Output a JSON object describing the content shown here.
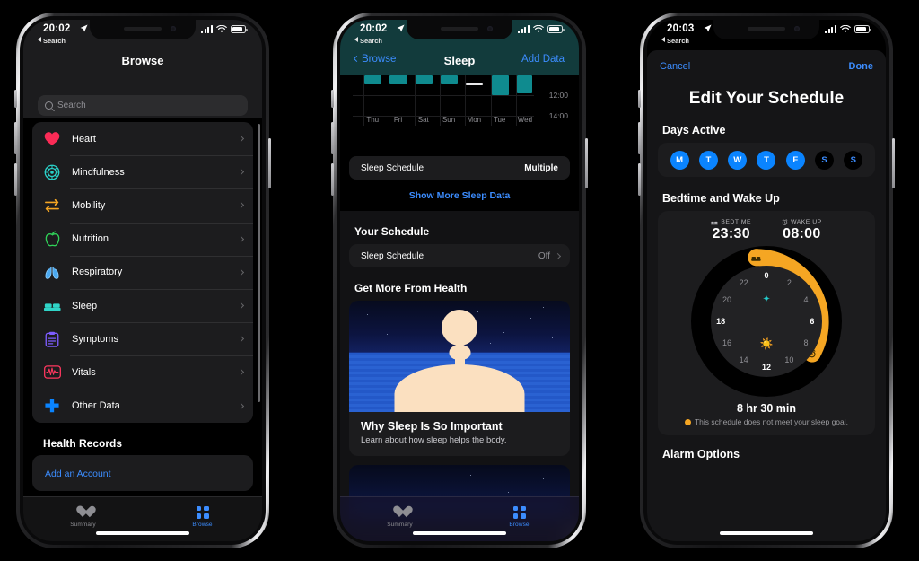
{
  "phone1": {
    "status": {
      "time": "20:02",
      "back_label": "Search",
      "location_icon": "location-arrow-icon",
      "signal_icon": "signal-bars-icon",
      "wifi_icon": "wifi-icon",
      "battery_icon": "battery-icon"
    },
    "nav": {
      "title": "Browse"
    },
    "search": {
      "placeholder": "Search",
      "icon": "search-icon"
    },
    "categories": [
      {
        "label": "Heart",
        "icon": "heart-icon",
        "color": "#fa2b56"
      },
      {
        "label": "Mindfulness",
        "icon": "mindfulness-icon",
        "color": "#2ad0c8"
      },
      {
        "label": "Mobility",
        "icon": "mobility-icon",
        "color": "#f5a623"
      },
      {
        "label": "Nutrition",
        "icon": "apple-icon",
        "color": "#30d158"
      },
      {
        "label": "Respiratory",
        "icon": "lungs-icon",
        "color": "#5ac8fa"
      },
      {
        "label": "Sleep",
        "icon": "bed-icon",
        "color": "#30d5c8"
      },
      {
        "label": "Symptoms",
        "icon": "clipboard-icon",
        "color": "#7d5cff"
      },
      {
        "label": "Vitals",
        "icon": "waveform-icon",
        "color": "#ff375f"
      },
      {
        "label": "Other Data",
        "icon": "plus-icon",
        "color": "#0a84ff"
      }
    ],
    "health_records": {
      "title": "Health Records",
      "action": "Add an Account"
    },
    "tabs": [
      {
        "label": "Summary",
        "icon": "heart-icon",
        "active": false
      },
      {
        "label": "Browse",
        "icon": "grid-icon",
        "active": true
      }
    ]
  },
  "phone2": {
    "status": {
      "time": "20:02",
      "back_label": "Search"
    },
    "nav": {
      "back": "Browse",
      "title": "Sleep",
      "action": "Add Data"
    },
    "chart_data": {
      "type": "bar",
      "title": "Sleep",
      "categories": [
        "Thu",
        "Fri",
        "Sat",
        "Sun",
        "Mon",
        "Tue",
        "Wed"
      ],
      "values": [
        1.0,
        1.0,
        1.0,
        1.0,
        0.1,
        2.1,
        2.0
      ],
      "ytick_labels": [
        "12:00",
        "14:00"
      ],
      "xlabel": "",
      "ylabel": "",
      "series_color": "#0f8b8f",
      "grid": true,
      "legend": "none"
    },
    "sleep_schedule_pill": {
      "label": "Sleep Schedule",
      "value": "Multiple"
    },
    "show_more": "Show More Sleep Data",
    "your_schedule": {
      "title": "Your Schedule",
      "row_label": "Sleep Schedule",
      "row_value": "Off"
    },
    "get_more": {
      "title": "Get More From Health",
      "card": {
        "title": "Why Sleep Is So Important",
        "subtitle": "Learn about how sleep helps the body."
      }
    },
    "tabs": [
      {
        "label": "Summary",
        "icon": "heart-icon",
        "active": false
      },
      {
        "label": "Browse",
        "icon": "grid-icon",
        "active": true
      }
    ]
  },
  "phone3": {
    "status": {
      "time": "20:03",
      "back_label": "Search"
    },
    "modal_nav": {
      "cancel": "Cancel",
      "done": "Done"
    },
    "title": "Edit Your Schedule",
    "days_active": {
      "heading": "Days Active",
      "days": [
        {
          "letter": "M",
          "active": true
        },
        {
          "letter": "T",
          "active": true
        },
        {
          "letter": "W",
          "active": true
        },
        {
          "letter": "T",
          "active": true
        },
        {
          "letter": "F",
          "active": true
        },
        {
          "letter": "S",
          "active": false
        },
        {
          "letter": "S",
          "active": false
        }
      ]
    },
    "bedtime_wakeup": {
      "heading": "Bedtime and Wake Up",
      "bedtime_label": "BEDTIME",
      "bedtime_icon": "bed-icon",
      "bedtime_value": "23:30",
      "wakeup_label": "WAKE UP",
      "wakeup_icon": "alarm-icon",
      "wakeup_value": "08:00",
      "dial_numbers": [
        "0",
        "2",
        "4",
        "6",
        "8",
        "10",
        "12",
        "14",
        "16",
        "18",
        "20",
        "22"
      ],
      "arc_color": "#f5a623",
      "duration": "8 hr 30 min",
      "warning": "This schedule does not meet your sleep goal.",
      "warning_color": "#f5a623",
      "night_icon": "star-icon",
      "day_icon": "sun-icon"
    },
    "alarm_options": "Alarm Options"
  }
}
